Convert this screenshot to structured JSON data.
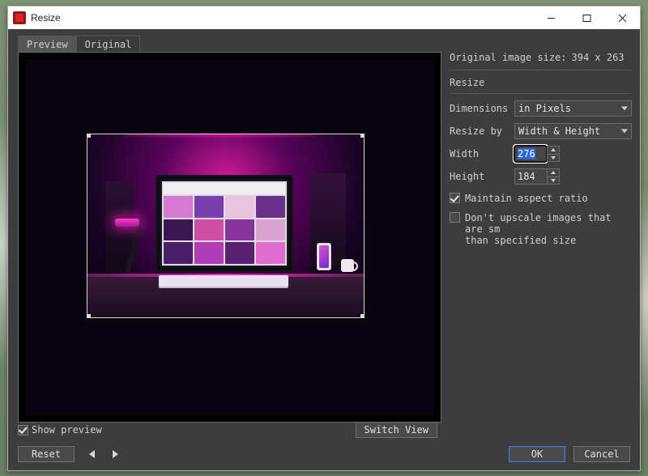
{
  "window": {
    "title": "Resize"
  },
  "tabs": {
    "preview": "Preview",
    "original": "Original",
    "active": "preview"
  },
  "info": {
    "original_size_label": "Original image size:",
    "original_size_value": "394 x 263"
  },
  "resize": {
    "section_label": "Resize",
    "dimensions_label": "Dimensions",
    "dimensions_value": "in Pixels",
    "resize_by_label": "Resize by",
    "resize_by_value": "Width & Height",
    "width_label": "Width",
    "width_value": "276",
    "height_label": "Height",
    "height_value": "184",
    "maintain_label": "Maintain aspect ratio",
    "maintain_checked": true,
    "no_upscale_label": "Don't upscale images that are sm\nthan specified size",
    "no_upscale_checked": false
  },
  "preview_controls": {
    "show_preview_label": "Show preview",
    "show_preview_checked": true,
    "switch_view_label": "Switch View"
  },
  "footer": {
    "reset_label": "Reset",
    "ok_label": "OK",
    "cancel_label": "Cancel"
  },
  "thumb_colors": [
    "#d67ad1",
    "#7a3fae",
    "#e7c4e0",
    "#6b2f8c",
    "#3b1650",
    "#cf4fa6",
    "#86349c",
    "#d9a4d0",
    "#4a1e66",
    "#b13cb8",
    "#5a2170",
    "#e06ccd"
  ]
}
